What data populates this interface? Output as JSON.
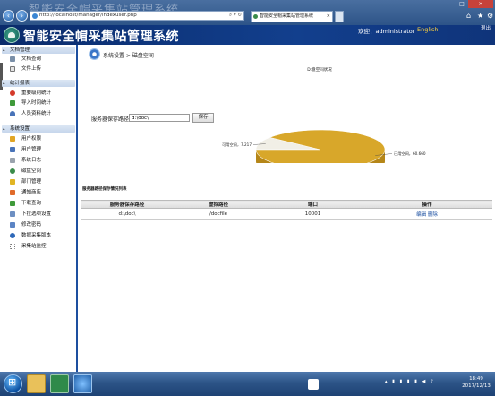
{
  "browser": {
    "url": "http://localhost/manager/indexuser.php",
    "tab_title": "智能安全帽采集站管理系统",
    "watermark_title": "智能安全帽采集站管理系统"
  },
  "header": {
    "title": "智能安全帽采集站管理系统",
    "welcome": "欢迎：administrator",
    "lang": "English",
    "logout": "退出"
  },
  "sidebar": {
    "groups": [
      {
        "label": "文档管理",
        "items": [
          "文档查询",
          "文件上传"
        ]
      },
      {
        "label": "统计报表",
        "items": [
          "重要级别统计",
          "导入时间统计",
          "人员资料统计"
        ]
      },
      {
        "label": "系统设置",
        "items": [
          "用户权限",
          "用户管理",
          "系统日志",
          "磁盘空间",
          "部门管理",
          "通知商店",
          "下载查询",
          "下拉选项设置",
          "修改密码",
          "数据采集版本",
          "采集站监控"
        ]
      }
    ]
  },
  "content": {
    "breadcrumb": "系统设置 > 磁盘空间",
    "path_label": "服务器保存路径：",
    "path_value": "d:\\doc\\",
    "save_button": "保存",
    "table_caption": "服务器路径保存情况列表",
    "table": {
      "headers": [
        "服务器保存路径",
        "虚拟路径",
        "端口",
        "操作"
      ],
      "rows": [
        {
          "path": "d:\\doc\\",
          "virtual": "/docfile",
          "port": "10001",
          "edit": "编辑",
          "delete": "删除"
        }
      ]
    }
  },
  "chart_data": {
    "type": "pie",
    "title": "D:盘空间状况",
    "categories": [
      "可用空间",
      "已用空间"
    ],
    "values": [
      7.217,
      60.66
    ],
    "labels": [
      "可用空间，7.217",
      "已用空间，60.660"
    ],
    "colors": [
      "#f1efe6",
      "#d8a72a"
    ]
  },
  "taskbar": {
    "time": "18:49",
    "date": "2017/12/13"
  }
}
